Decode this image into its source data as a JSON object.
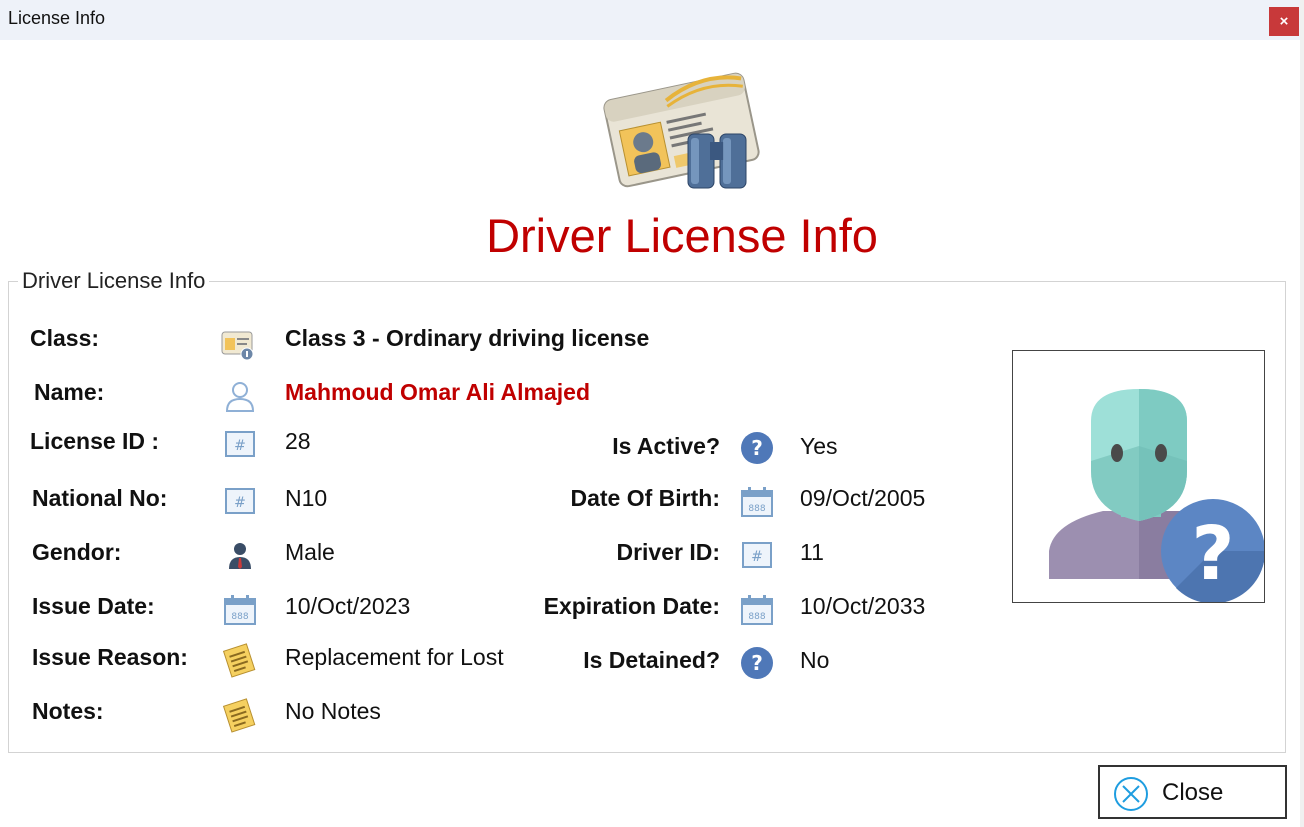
{
  "window": {
    "title": "License Info",
    "close_glyph": "×"
  },
  "header": {
    "title": "Driver License Info",
    "icon": "license-binoculars-icon"
  },
  "group": {
    "title": "Driver License Info"
  },
  "fields": {
    "class": {
      "label": "Class:",
      "value": "Class 3 - Ordinary driving license",
      "icon": "license-card-icon"
    },
    "name": {
      "label": "Name:",
      "value": "Mahmoud Omar Ali Almajed",
      "icon": "person-outline-icon"
    },
    "license_id": {
      "label": "License ID :",
      "value": "28",
      "icon": "id-number-icon"
    },
    "is_active": {
      "label": "Is Active?",
      "value": "Yes",
      "icon": "question-icon"
    },
    "national_no": {
      "label": "National No:",
      "value": "N10",
      "icon": "id-number-icon"
    },
    "date_of_birth": {
      "label": "Date Of Birth:",
      "value": "09/Oct/2005",
      "icon": "calendar-icon"
    },
    "gender": {
      "label": "Gendor:",
      "value": "Male",
      "icon": "male-person-icon"
    },
    "driver_id": {
      "label": "Driver ID:",
      "value": "11",
      "icon": "id-number-icon"
    },
    "issue_date": {
      "label": "Issue Date:",
      "value": "10/Oct/2023",
      "icon": "calendar-icon"
    },
    "expiration_date": {
      "label": "Expiration Date:",
      "value": "10/Oct/2033",
      "icon": "calendar-icon"
    },
    "issue_reason": {
      "label": "Issue Reason:",
      "value": "Replacement for Lost",
      "icon": "notepad-icon"
    },
    "is_detained": {
      "label": "Is Detained?",
      "value": "No",
      "icon": "question-icon"
    },
    "notes": {
      "label": "Notes:",
      "value": "No Notes",
      "icon": "notepad-icon"
    }
  },
  "photo": {
    "icon": "unknown-person-icon"
  },
  "close_button": {
    "label": "Close",
    "icon": "close-circle-icon"
  },
  "colors": {
    "accent_red": "#c00000",
    "titlebar": "#eef2f9",
    "close_red": "#c8393a"
  }
}
